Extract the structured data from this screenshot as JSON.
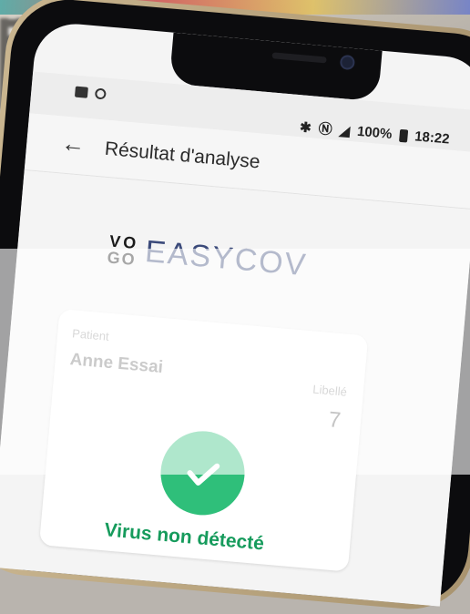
{
  "status_bar": {
    "battery": "100%",
    "time": "18:22"
  },
  "app_bar": {
    "back_icon": "arrow-back-icon",
    "title": "Résultat d'analyse"
  },
  "logo": {
    "brand_left": [
      "V",
      "O",
      "G",
      "O"
    ],
    "brand_right": "EASYCOV"
  },
  "result_card": {
    "patient_label": "Patient",
    "patient_name": "Anne Essai",
    "libelle_label": "Libellé",
    "libelle_value": "7",
    "result_icon": "check-circle-icon",
    "result_text": "Virus non détecté",
    "colors": {
      "success": "#2fbf7a",
      "success_text": "#169b5c"
    }
  }
}
